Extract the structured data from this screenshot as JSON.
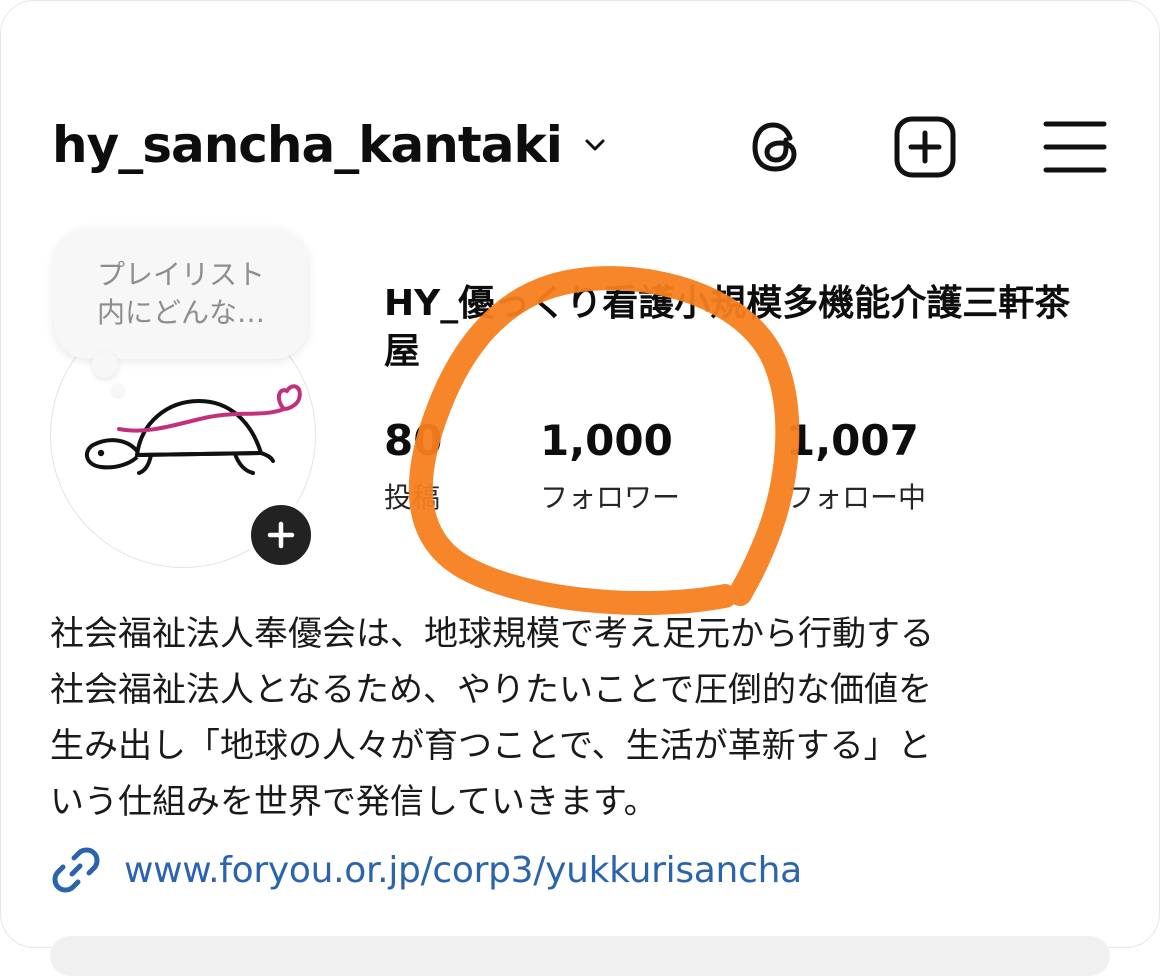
{
  "header": {
    "username": "hy_sancha_kantaki"
  },
  "note": {
    "line1": "プレイリスト",
    "line2": "内にどんな…"
  },
  "profile": {
    "display_name": "HY_優っくり看護小規模多機能介護三軒茶屋"
  },
  "stats": {
    "posts": {
      "value": "80",
      "label": "投稿"
    },
    "followers": {
      "value": "1,000",
      "label": "フォロワー"
    },
    "following": {
      "value": "1,007",
      "label": "フォロー中"
    }
  },
  "bio": {
    "lines": [
      "社会福祉法人奉優会は、地球規模で考え足元から行動する",
      "社会福祉法人となるため、やりたいことで圧倒的な価値を",
      "生み出し「地球の人々が育つことで、生活が革新する」と",
      "いう仕組みを世界で発信していきます。"
    ]
  },
  "link": {
    "text": "www.foryou.or.jp/corp3/yukkurisancha"
  },
  "colors": {
    "annotation_orange": "#f7801f",
    "link_blue": "#2b64ad",
    "turtle_pink": "#c2307c"
  },
  "icons": {
    "header": [
      "chevron-down-icon",
      "threads-icon",
      "create-icon",
      "menu-icon"
    ],
    "avatar": [
      "turtle-icon",
      "add-story-icon"
    ],
    "link": "link-icon"
  }
}
